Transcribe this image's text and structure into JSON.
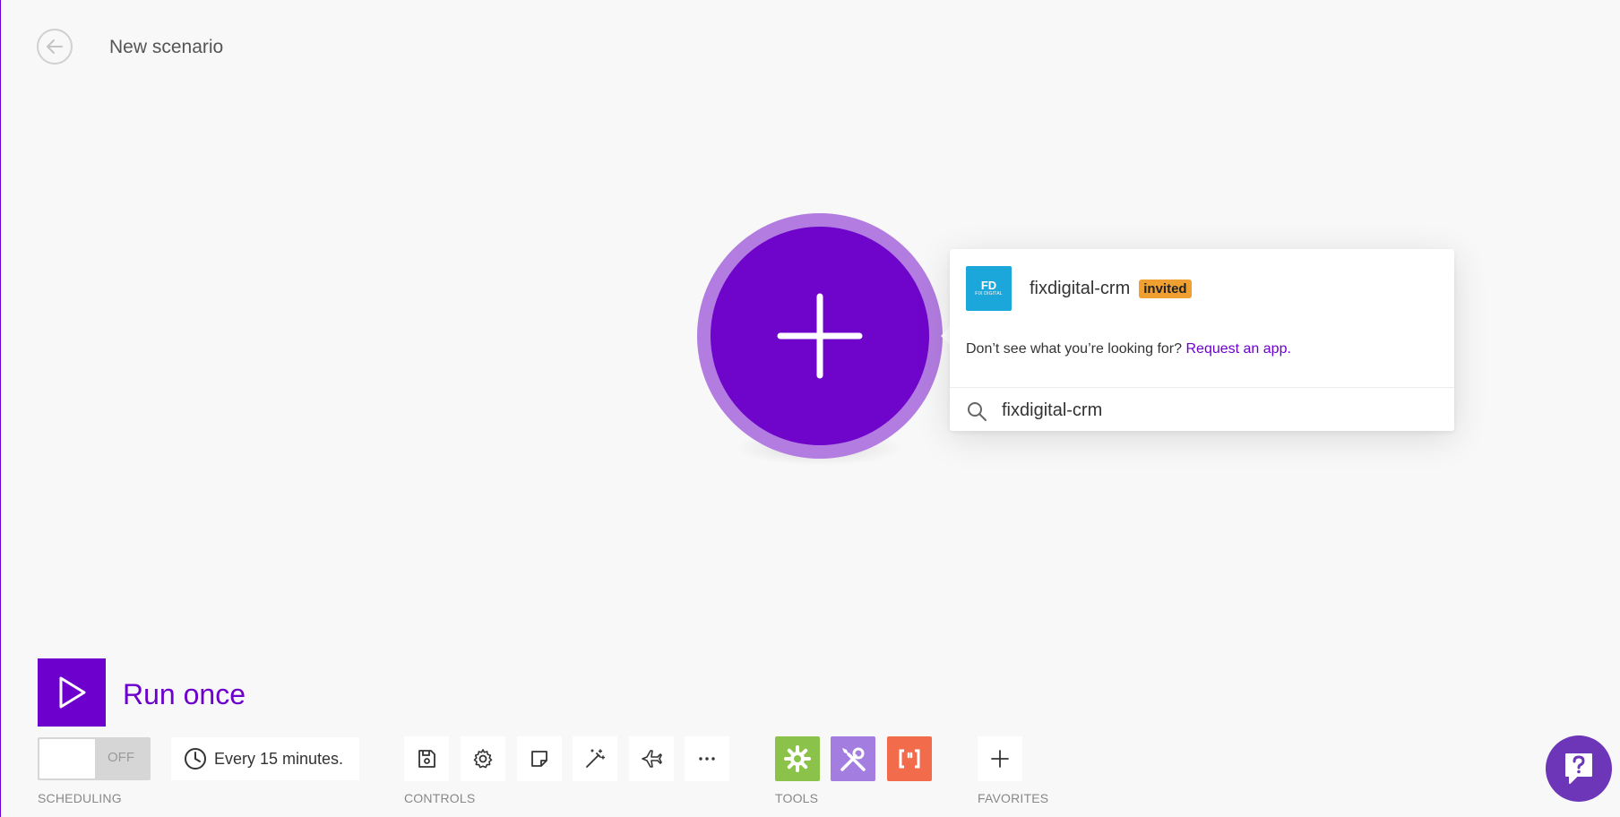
{
  "header": {
    "title": "New scenario"
  },
  "popup": {
    "app": {
      "name": "fixdigital-crm",
      "badge": "invited",
      "logo_mark": "FD",
      "logo_word": "FIX DIGITAL"
    },
    "request_text": "Don’t see what you’re looking for?",
    "request_link": "Request an app.",
    "search": {
      "value": "fixdigital-crm",
      "icon": "search-icon"
    }
  },
  "toolbar": {
    "run_once_label": "Run once",
    "scheduling": {
      "toggle_state": "OFF",
      "interval": "Every 15 minutes.",
      "section_label": "SCHEDULING"
    },
    "controls": {
      "section_label": "CONTROLS",
      "icons": [
        "save-icon",
        "gear-icon",
        "note-icon",
        "magic-wand-icon",
        "airplane-icon",
        "more-icon"
      ]
    },
    "tools": {
      "section_label": "TOOLS",
      "items": [
        {
          "icon": "gear-icon",
          "color": "#8bc34a"
        },
        {
          "icon": "wrench-screwdriver-icon",
          "color": "#a37ee0"
        },
        {
          "icon": "json-brackets-icon",
          "color": "#f26b4b"
        }
      ]
    },
    "favorites": {
      "section_label": "FAVORITES"
    }
  },
  "colors": {
    "accent": "#6d00cc",
    "module_core": "#6f04cb",
    "module_ring": "#b27ce0",
    "badge": "#f0a030",
    "app_logo": "#1ba7da",
    "help": "#6d36b9"
  }
}
